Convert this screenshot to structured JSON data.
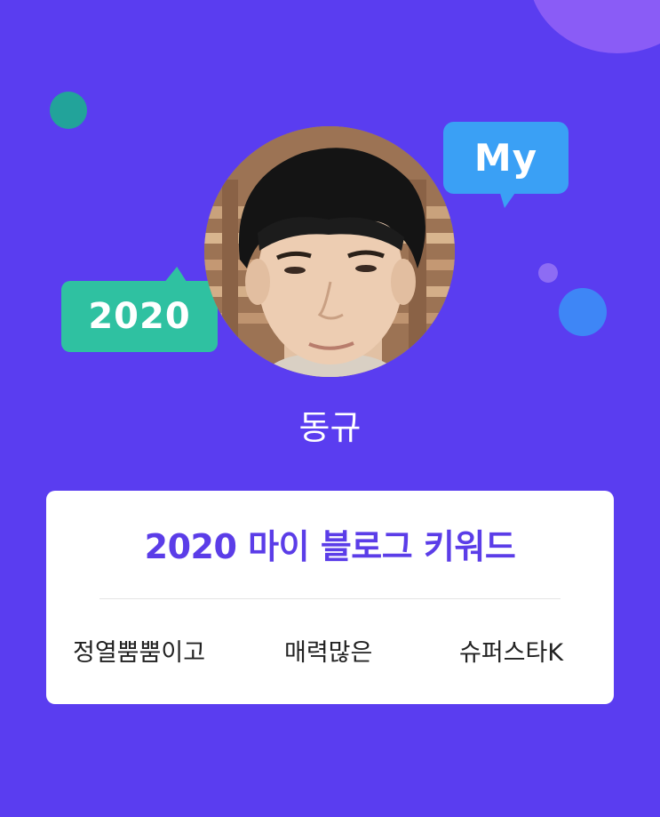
{
  "colors": {
    "background": "#5a3df0",
    "accent_text": "#5b3de8",
    "bubble_my": "#3aa0f5",
    "bubble_year": "#2fc1a1"
  },
  "bubbles": {
    "my_label": "My",
    "year_label": "2020"
  },
  "profile": {
    "name": "동규"
  },
  "card": {
    "title": "2020 마이 블로그 키워드",
    "keywords": [
      "정열뿜뿜이고",
      "매력많은",
      "슈퍼스타K"
    ]
  }
}
